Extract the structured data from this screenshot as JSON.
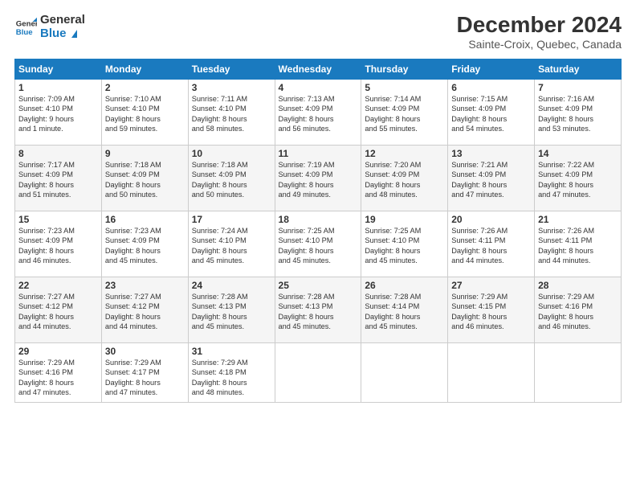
{
  "logo": {
    "line1": "General",
    "line2": "Blue"
  },
  "title": "December 2024",
  "subtitle": "Sainte-Croix, Quebec, Canada",
  "weekdays": [
    "Sunday",
    "Monday",
    "Tuesday",
    "Wednesday",
    "Thursday",
    "Friday",
    "Saturday"
  ],
  "weeks": [
    [
      {
        "day": "1",
        "info": "Sunrise: 7:09 AM\nSunset: 4:10 PM\nDaylight: 9 hours\nand 1 minute."
      },
      {
        "day": "2",
        "info": "Sunrise: 7:10 AM\nSunset: 4:10 PM\nDaylight: 8 hours\nand 59 minutes."
      },
      {
        "day": "3",
        "info": "Sunrise: 7:11 AM\nSunset: 4:10 PM\nDaylight: 8 hours\nand 58 minutes."
      },
      {
        "day": "4",
        "info": "Sunrise: 7:13 AM\nSunset: 4:09 PM\nDaylight: 8 hours\nand 56 minutes."
      },
      {
        "day": "5",
        "info": "Sunrise: 7:14 AM\nSunset: 4:09 PM\nDaylight: 8 hours\nand 55 minutes."
      },
      {
        "day": "6",
        "info": "Sunrise: 7:15 AM\nSunset: 4:09 PM\nDaylight: 8 hours\nand 54 minutes."
      },
      {
        "day": "7",
        "info": "Sunrise: 7:16 AM\nSunset: 4:09 PM\nDaylight: 8 hours\nand 53 minutes."
      }
    ],
    [
      {
        "day": "8",
        "info": "Sunrise: 7:17 AM\nSunset: 4:09 PM\nDaylight: 8 hours\nand 51 minutes."
      },
      {
        "day": "9",
        "info": "Sunrise: 7:18 AM\nSunset: 4:09 PM\nDaylight: 8 hours\nand 50 minutes."
      },
      {
        "day": "10",
        "info": "Sunrise: 7:18 AM\nSunset: 4:09 PM\nDaylight: 8 hours\nand 50 minutes."
      },
      {
        "day": "11",
        "info": "Sunrise: 7:19 AM\nSunset: 4:09 PM\nDaylight: 8 hours\nand 49 minutes."
      },
      {
        "day": "12",
        "info": "Sunrise: 7:20 AM\nSunset: 4:09 PM\nDaylight: 8 hours\nand 48 minutes."
      },
      {
        "day": "13",
        "info": "Sunrise: 7:21 AM\nSunset: 4:09 PM\nDaylight: 8 hours\nand 47 minutes."
      },
      {
        "day": "14",
        "info": "Sunrise: 7:22 AM\nSunset: 4:09 PM\nDaylight: 8 hours\nand 47 minutes."
      }
    ],
    [
      {
        "day": "15",
        "info": "Sunrise: 7:23 AM\nSunset: 4:09 PM\nDaylight: 8 hours\nand 46 minutes."
      },
      {
        "day": "16",
        "info": "Sunrise: 7:23 AM\nSunset: 4:09 PM\nDaylight: 8 hours\nand 45 minutes."
      },
      {
        "day": "17",
        "info": "Sunrise: 7:24 AM\nSunset: 4:10 PM\nDaylight: 8 hours\nand 45 minutes."
      },
      {
        "day": "18",
        "info": "Sunrise: 7:25 AM\nSunset: 4:10 PM\nDaylight: 8 hours\nand 45 minutes."
      },
      {
        "day": "19",
        "info": "Sunrise: 7:25 AM\nSunset: 4:10 PM\nDaylight: 8 hours\nand 45 minutes."
      },
      {
        "day": "20",
        "info": "Sunrise: 7:26 AM\nSunset: 4:11 PM\nDaylight: 8 hours\nand 44 minutes."
      },
      {
        "day": "21",
        "info": "Sunrise: 7:26 AM\nSunset: 4:11 PM\nDaylight: 8 hours\nand 44 minutes."
      }
    ],
    [
      {
        "day": "22",
        "info": "Sunrise: 7:27 AM\nSunset: 4:12 PM\nDaylight: 8 hours\nand 44 minutes."
      },
      {
        "day": "23",
        "info": "Sunrise: 7:27 AM\nSunset: 4:12 PM\nDaylight: 8 hours\nand 44 minutes."
      },
      {
        "day": "24",
        "info": "Sunrise: 7:28 AM\nSunset: 4:13 PM\nDaylight: 8 hours\nand 45 minutes."
      },
      {
        "day": "25",
        "info": "Sunrise: 7:28 AM\nSunset: 4:13 PM\nDaylight: 8 hours\nand 45 minutes."
      },
      {
        "day": "26",
        "info": "Sunrise: 7:28 AM\nSunset: 4:14 PM\nDaylight: 8 hours\nand 45 minutes."
      },
      {
        "day": "27",
        "info": "Sunrise: 7:29 AM\nSunset: 4:15 PM\nDaylight: 8 hours\nand 46 minutes."
      },
      {
        "day": "28",
        "info": "Sunrise: 7:29 AM\nSunset: 4:16 PM\nDaylight: 8 hours\nand 46 minutes."
      }
    ],
    [
      {
        "day": "29",
        "info": "Sunrise: 7:29 AM\nSunset: 4:16 PM\nDaylight: 8 hours\nand 47 minutes."
      },
      {
        "day": "30",
        "info": "Sunrise: 7:29 AM\nSunset: 4:17 PM\nDaylight: 8 hours\nand 47 minutes."
      },
      {
        "day": "31",
        "info": "Sunrise: 7:29 AM\nSunset: 4:18 PM\nDaylight: 8 hours\nand 48 minutes."
      },
      null,
      null,
      null,
      null
    ]
  ]
}
